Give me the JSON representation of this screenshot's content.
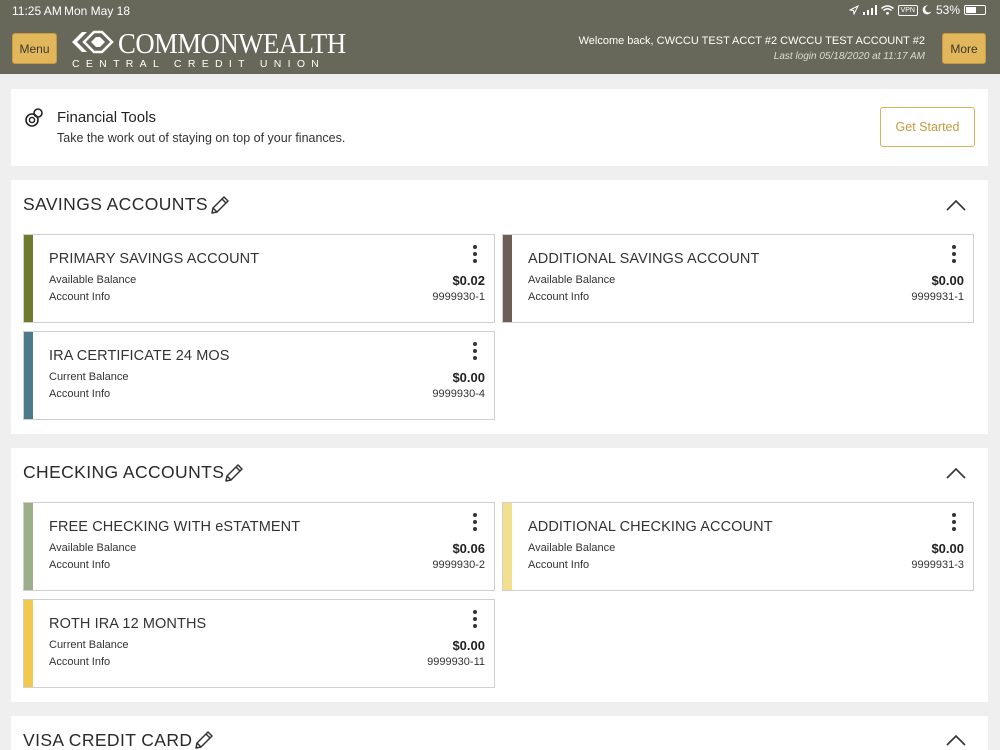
{
  "status_bar": {
    "time": "11:25 AM",
    "date": "Mon May 18",
    "vpn": "VPN",
    "battery": "53%",
    "icons": [
      "location-icon",
      "signal-icon",
      "wifi-icon",
      "vpn-icon",
      "moon-icon",
      "battery-icon"
    ]
  },
  "header": {
    "menu_label": "Menu",
    "more_label": "More",
    "logo_name": "COMMONWEALTH",
    "logo_sub": "CENTRAL CREDIT UNION",
    "welcome": "Welcome back, CWCCU TEST ACCT #2 CWCCU TEST ACCOUNT #2",
    "last_login": "Last login 05/18/2020 at 11:17 AM",
    "background": "#67685a",
    "button_color": "#e2b75c"
  },
  "financial_tools": {
    "title": "Financial Tools",
    "description": "Take the work out of staying on top of your finances.",
    "button_label": "Get Started"
  },
  "savings": {
    "title": "SAVINGS ACCOUNTS",
    "accounts": [
      {
        "name": "PRIMARY SAVINGS ACCOUNT",
        "balance_label": "Available Balance",
        "balance": "$0.02",
        "info_label": "Account Info",
        "account_number": "9999930-1",
        "color": "#6f7a2a"
      },
      {
        "name": "ADDITIONAL SAVINGS ACCOUNT",
        "balance_label": "Available Balance",
        "balance": "$0.00",
        "info_label": "Account Info",
        "account_number": "9999931-1",
        "color": "#6b5f58"
      },
      {
        "name": "IRA CERTIFICATE 24 MOS",
        "balance_label": "Current Balance",
        "balance": "$0.00",
        "info_label": "Account Info",
        "account_number": "9999930-4",
        "color": "#4d7a8a"
      }
    ]
  },
  "checking": {
    "title": "CHECKING ACCOUNTS",
    "accounts": [
      {
        "name": "FREE CHECKING WITH eSTATMENT",
        "balance_label": "Available Balance",
        "balance": "$0.06",
        "info_label": "Account Info",
        "account_number": "9999930-2",
        "color": "#9caf88"
      },
      {
        "name": "ADDITIONAL CHECKING ACCOUNT",
        "balance_label": "Available Balance",
        "balance": "$0.00",
        "info_label": "Account Info",
        "account_number": "9999931-3",
        "color": "#f3e08e"
      },
      {
        "name": "ROTH IRA 12 MONTHS",
        "balance_label": "Current Balance",
        "balance": "$0.00",
        "info_label": "Account Info",
        "account_number": "9999930-11",
        "color": "#f2c94c"
      }
    ]
  },
  "visa": {
    "title": "VISA CREDIT CARD"
  }
}
